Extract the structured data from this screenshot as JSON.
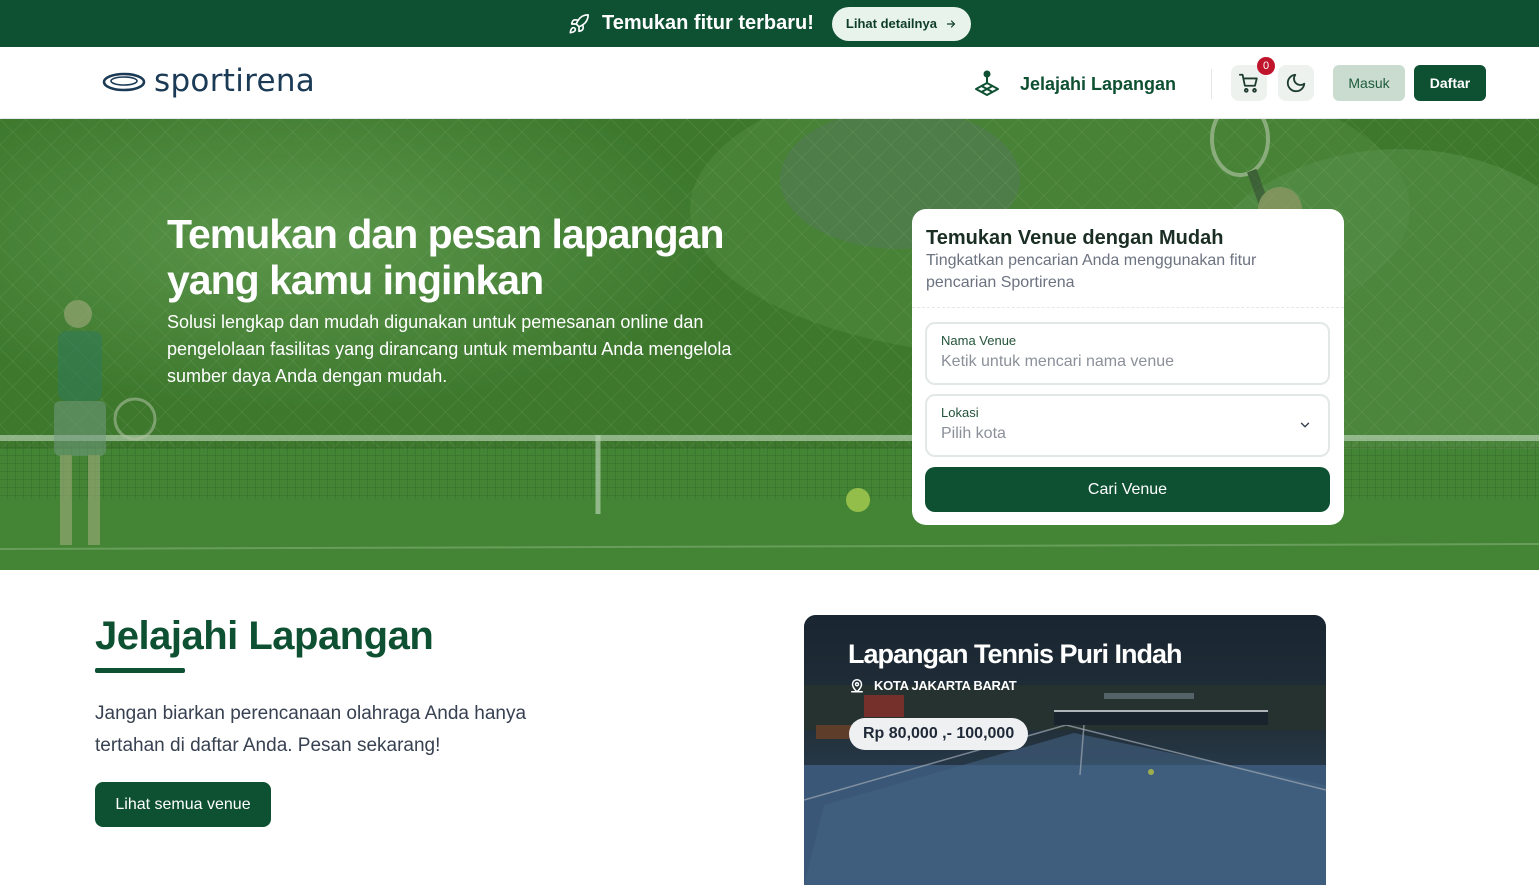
{
  "announcement": {
    "icon": "rocket-icon",
    "text": "Temukan fitur terbaru!",
    "button_label": "Lihat detailnya",
    "background": "#0e5032"
  },
  "navbar": {
    "logo_text": "sportirena",
    "explore_label": "Jelajahi Lapangan",
    "cart_count": "0",
    "login_label": "Masuk",
    "register_label": "Daftar"
  },
  "hero": {
    "title": "Temukan dan pesan lapangan yang kamu inginkan",
    "subtitle": "Solusi lengkap dan mudah digunakan untuk pemesanan online dan pengelolaan fasilitas yang dirancang untuk membantu Anda mengelola sumber daya Anda dengan mudah."
  },
  "search": {
    "title": "Temukan Venue dengan Mudah",
    "subtitle": "Tingkatkan pencarian Anda menggunakan fitur pencarian Sportirena",
    "venue_label": "Nama Venue",
    "venue_placeholder": "Ketik untuk mencari nama venue",
    "location_label": "Lokasi",
    "location_placeholder": "Pilih kota",
    "submit_label": "Cari Venue"
  },
  "explore": {
    "title": "Jelajahi Lapangan",
    "description": "Jangan biarkan perencanaan olahraga Anda hanya tertahan di daftar Anda. Pesan sekarang!",
    "button_label": "Lihat semua venue"
  },
  "venue_card": {
    "name": "Lapangan Tennis Puri Indah",
    "location": "KOTA JAKARTA BARAT",
    "price": "Rp 80,000 ,- 100,000"
  },
  "colors": {
    "brand": "#0e5032",
    "badge": "#c0142c"
  }
}
